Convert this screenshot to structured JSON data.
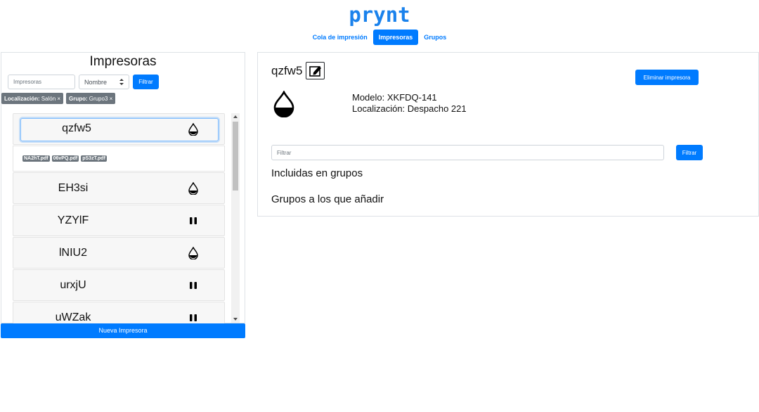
{
  "brand": "prynt",
  "nav": {
    "tabs": [
      {
        "label": "Cola de impresión",
        "active": false
      },
      {
        "label": "Impresoras",
        "active": true
      },
      {
        "label": "Grupos",
        "active": false
      }
    ]
  },
  "sidebar": {
    "title": "Impresoras",
    "search_placeholder": "Impresoras",
    "sort_value": "Nombre",
    "filter_label": "Filtrar",
    "chips": [
      {
        "key": "Localización:",
        "value": "Salón ×"
      },
      {
        "key": "Grupo:",
        "value": "Grupo3 ×"
      }
    ],
    "selected": {
      "name": "qzfw5",
      "status_icon": "drop-icon"
    },
    "files": [
      "NA2hT.pdf",
      "06vPQ.pdf",
      "pS3zT.pdf"
    ],
    "printers": [
      {
        "name": "EH3si",
        "status_icon": "drop-icon"
      },
      {
        "name": "YZYlF",
        "status_icon": "pause-icon"
      },
      {
        "name": "lNIU2",
        "status_icon": "drop-icon"
      },
      {
        "name": "urxjU",
        "status_icon": "pause-icon"
      },
      {
        "name": "uWZak",
        "status_icon": "pause-icon"
      }
    ],
    "new_button": "Nueva Impresora"
  },
  "detail": {
    "name": "qzfw5",
    "delete_button": "Eliminar impresora",
    "model": "Modelo: XKFDQ-141",
    "location": "Localización: Despacho 221",
    "filter_placeholder": "Filtrar",
    "filter_button": "Filtrar",
    "included_heading": "Incluidas en grupos",
    "add_heading": "Grupos a los que añadir"
  },
  "colors": {
    "primary": "#007bff",
    "brand": "#1a82ec",
    "chip": "#6c757d"
  }
}
